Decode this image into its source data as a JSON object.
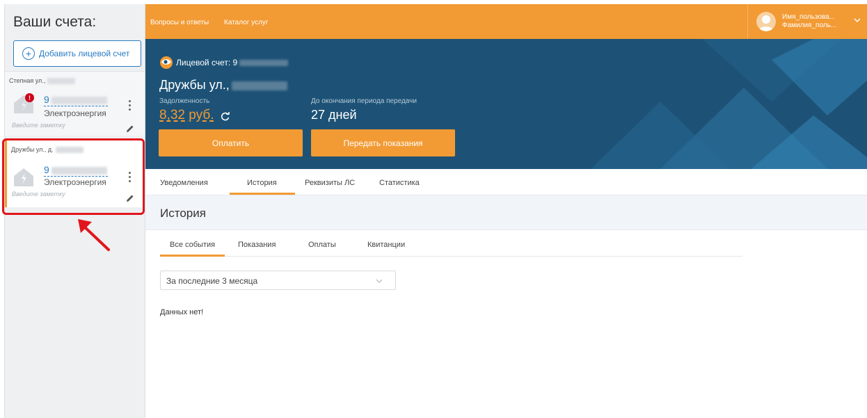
{
  "sidebar": {
    "title": "Ваши счета:",
    "add_label": "Добавить лицевой счет",
    "accounts": [
      {
        "address": "Степная ул.,",
        "number": "9",
        "type": "Электроэнергия",
        "note_placeholder": "Введите заметку",
        "alert": "!"
      },
      {
        "address": "Дружбы ул., д.",
        "number": "9",
        "type": "Электроэнергия",
        "note_placeholder": "Введите заметку"
      }
    ]
  },
  "topbar": {
    "links": [
      "Вопросы и ответы",
      "Каталог услуг"
    ],
    "user_first": "Имя_пользова...",
    "user_last": "Фамилия_поль..."
  },
  "hero": {
    "account_label": "Лицевой счет: 9",
    "address": "Дружбы ул.,",
    "debt_label": "Задолженность",
    "debt_value": "8,32 руб.",
    "period_label": "До окончания периода передачи",
    "period_value": "27 дней",
    "pay_label": "Оплатить",
    "send_label": "Передать показания"
  },
  "tabs": [
    "Уведомления",
    "История",
    "Реквизиты ЛС",
    "Статистика"
  ],
  "active_tab": "История",
  "section_title": "История",
  "subtabs": [
    "Все события",
    "Показания",
    "Оплаты",
    "Квитанции"
  ],
  "filter": {
    "value": "За последние 3 месяца"
  },
  "empty_message": "Данных нет!",
  "colors": {
    "accent": "#f29a33",
    "hero_bg": "#1d5276",
    "link": "#2a7cc4",
    "highlight": "#e0161c"
  }
}
